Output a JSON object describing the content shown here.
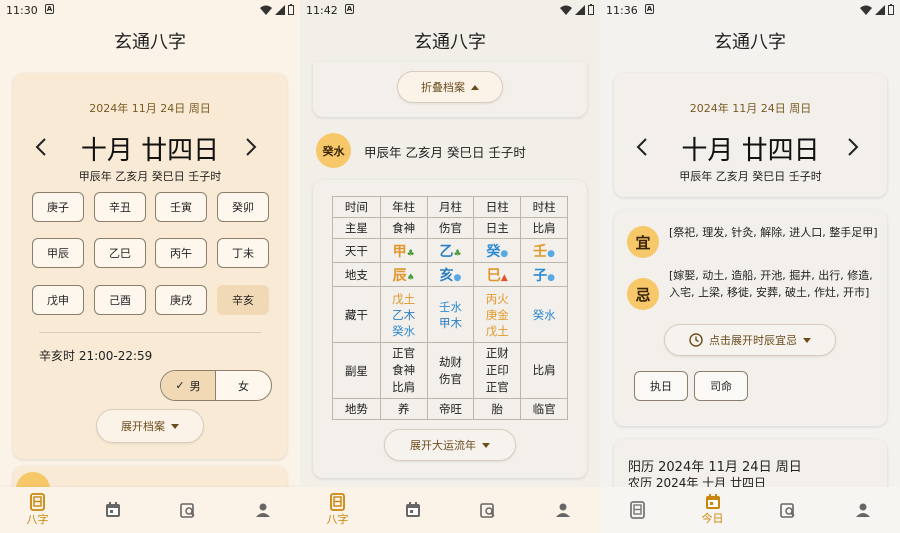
{
  "app_title": "玄通八字",
  "nav": {
    "bazi_label": "八字",
    "today_label": "今日"
  },
  "screen1": {
    "time": "11:30",
    "date_line": "2024年 11月 24日 周日",
    "lunar_big": "十月 廿四日",
    "ganzhi_line": "甲辰年 乙亥月 癸巳日 壬子时",
    "hours": [
      "庚子",
      "辛丑",
      "壬寅",
      "癸卯",
      "甲辰",
      "乙巳",
      "丙午",
      "丁未",
      "戊申",
      "己酉",
      "庚戌",
      "辛亥"
    ],
    "selected_hour_index": 11,
    "hour_range": "辛亥时 21:00-22:59",
    "gender_male": "男",
    "gender_female": "女",
    "gender_check": "✓",
    "expand_profile": "展开档案"
  },
  "screen2": {
    "time": "11:42",
    "collapse_profile": "折叠档案",
    "day_master": "癸水",
    "ganzhi_line": "甲辰年 乙亥月 癸巳日 壬子时",
    "table": {
      "headers": [
        "时间",
        "年柱",
        "月柱",
        "日柱",
        "时柱"
      ],
      "main_star": [
        "主星",
        "食神",
        "伤官",
        "日主",
        "比肩"
      ],
      "tiangan_label": "天干",
      "tiangan": [
        "甲",
        "乙",
        "癸",
        "壬"
      ],
      "dizhi_label": "地支",
      "dizhi": [
        "辰",
        "亥",
        "巳",
        "子"
      ],
      "canggan_label": "藏干",
      "canggan": [
        [
          "戊土",
          "乙木",
          "癸水"
        ],
        [
          "壬水",
          "甲木"
        ],
        [
          "丙火",
          "庚金",
          "戊土"
        ],
        [
          "癸水"
        ]
      ],
      "fuxing_label": "副星",
      "fuxing": [
        [
          "正官",
          "食神",
          "比肩"
        ],
        [
          "劫财",
          "伤官"
        ],
        [
          "正财",
          "正印",
          "正官"
        ],
        [
          "比肩"
        ]
      ],
      "dishi_label": "地势",
      "dishi": [
        "养",
        "帝旺",
        "胎",
        "临官"
      ]
    },
    "expand_dayun": "展开大运流年"
  },
  "screen3": {
    "time": "11:36",
    "date_line": "2024年 11月 24日 周日",
    "lunar_big": "十月 廿四日",
    "ganzhi_line": "甲辰年 乙亥月 癸巳日 壬子时",
    "yi_label": "宜",
    "yi_text": "[祭祀, 理发, 针灸, 解除, 进人口, 整手足甲]",
    "ji_label": "忌",
    "ji_text": "[嫁娶, 动土, 造船, 开池, 掘井, 出行, 修造, 入宅, 上梁, 移徙, 安葬, 破土, 作灶, 开市]",
    "expand_hour_yi": "点击展开时辰宜忌",
    "zhi_ri": "执日",
    "si_ming": "司命",
    "solar_line": "阳历 2024年 11月 24日 周日",
    "lunar_line": "农历 2024年 十月 廿四日"
  },
  "colors": {
    "accent": "#c9860b",
    "card_warm": "#f8ead4",
    "gold_circle": "#f6c86a"
  }
}
